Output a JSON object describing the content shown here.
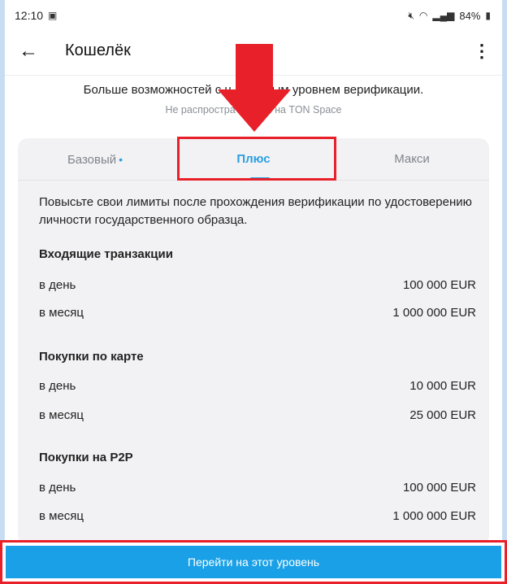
{
  "status_bar": {
    "time": "12:10",
    "battery": "84%",
    "icons": [
      "gallery-icon",
      "mute-icon",
      "wifi-icon",
      "signal-icon",
      "battery-icon"
    ]
  },
  "app_bar": {
    "title": "Кошелёк",
    "back_icon": "arrow-left-icon",
    "menu_icon": "more-vertical-icon"
  },
  "notice": {
    "text": "Больше возможностей с н          ным уровнем верификации.",
    "subtext": "Не распростра           я на TON Space"
  },
  "tabs": [
    {
      "label": "Базовый",
      "dot": "•",
      "selected": false
    },
    {
      "label": "Плюс",
      "selected": true
    },
    {
      "label": "Макси",
      "selected": false
    }
  ],
  "plus_level": {
    "description": "Повысьте свои лимиты после прохождения верификации по удостоверению личности государственного образца.",
    "sections": [
      {
        "title": "Входящие транзакции",
        "rows": [
          {
            "label": "в день",
            "value": "100 000 EUR"
          },
          {
            "label": "в месяц",
            "value": "1 000 000 EUR"
          }
        ]
      },
      {
        "title": "Покупки по карте",
        "rows": [
          {
            "label": "в день",
            "value": "10 000 EUR"
          },
          {
            "label": "в месяц",
            "value": "25 000 EUR"
          }
        ]
      },
      {
        "title": "Покупки на P2P",
        "rows": [
          {
            "label": "в день",
            "value": "100 000 EUR"
          },
          {
            "label": "в месяц",
            "value": "1 000 000 EUR"
          }
        ]
      }
    ]
  },
  "cta": {
    "label": "Перейти на этот уровень"
  },
  "colors": {
    "accent": "#2a9fe0",
    "cta": "#19a0e6",
    "annotation": "#e8202a",
    "card": "#f2f2f4"
  }
}
